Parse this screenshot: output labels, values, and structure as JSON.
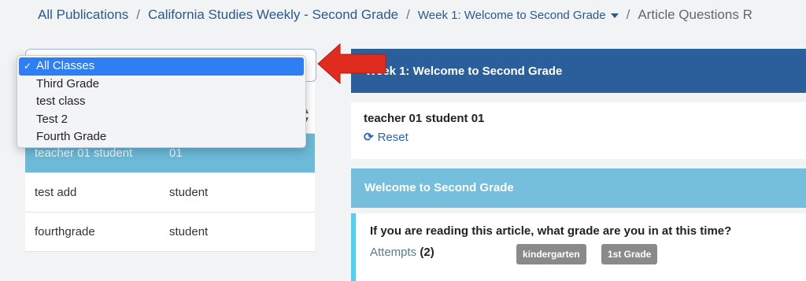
{
  "breadcrumb": {
    "items": [
      "All Publications",
      "California Studies Weekly - Second Grade",
      "Week 1: Welcome to Second Grade",
      "Article Questions R"
    ]
  },
  "class_filter": {
    "selected": "All Classes",
    "options": [
      "All Classes",
      "Third Grade",
      "test class",
      "Test 2",
      "Fourth Grade"
    ]
  },
  "student_table": {
    "rows": [
      {
        "name": "teacher 01 student",
        "role": "01",
        "selected": true
      },
      {
        "name": "test add",
        "role": "student",
        "selected": false
      },
      {
        "name": "fourthgrade",
        "role": "student",
        "selected": false
      }
    ]
  },
  "week_header": {
    "title": "Week 1: Welcome to Second Grade"
  },
  "student_card": {
    "name": "teacher 01 student 01",
    "reset_label": "Reset"
  },
  "article_header": {
    "title": "Welcome to Second Grade"
  },
  "question": {
    "text": "If you are reading this article, what grade are you in at this time?",
    "attempts_label": "Attempts",
    "attempts_count": "(2)",
    "answers": [
      "kindergarten",
      "1st Grade"
    ]
  },
  "colors": {
    "primary_blue": "#2a5f9b",
    "light_blue": "#75bfdd",
    "selected_row": "#6cbad8",
    "accent_arrow": "#e02b1f",
    "question_border": "#4fd0f0"
  }
}
